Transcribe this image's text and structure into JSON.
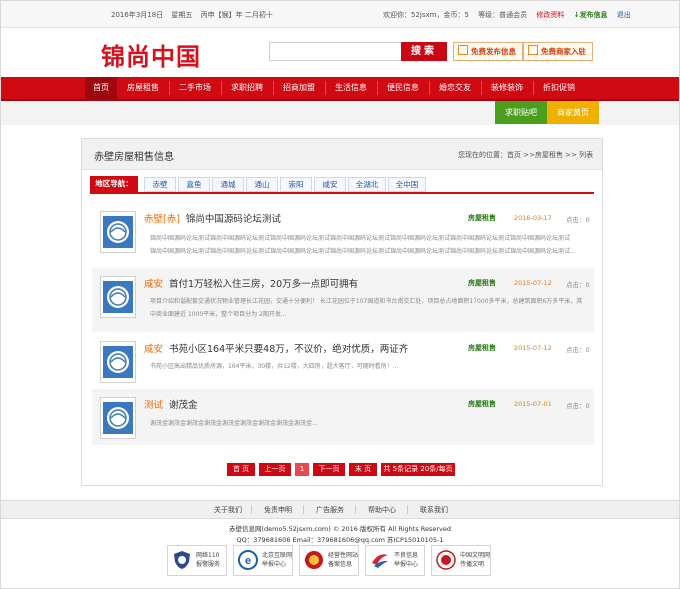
{
  "topbar": {
    "date": "2016年3月18日",
    "weekday": "星期五",
    "lunar": "丙申【猴】年 二月初十",
    "welcome": "欢迎你：52jsxm，金币：5",
    "level": "等级：普通会员",
    "edit_profile": "修改资料",
    "publish": "↓发布信息",
    "logout": "退出"
  },
  "header": {
    "logo_text": "锦尚中国",
    "search_button": "搜索",
    "free_publish": "免费发布信息",
    "free_merchant": "免费商家入驻"
  },
  "nav": {
    "items": [
      "首页",
      "房屋租售",
      "二手市场",
      "求职招聘",
      "招商加盟",
      "生活信息",
      "便民信息",
      "婚恋交友",
      "装修装饰",
      "折扣促销"
    ]
  },
  "sub_buttons": {
    "jobs": "求职贴吧",
    "merchants": "商家黄页"
  },
  "page": {
    "title": "赤壁房屋租售信息",
    "breadcrumb": "您现在的位置：首页 >>房屋租售 >> 列表"
  },
  "areas": {
    "label": "地区导航：",
    "items": [
      "赤壁",
      "嘉鱼",
      "通城",
      "通山",
      "崇阳",
      "咸安",
      "全湖北",
      "全中国"
    ]
  },
  "listings": [
    {
      "location": "赤壁[赤]",
      "title": "锦尚中国源码论坛测试",
      "category": "房屋租售",
      "date": "2016-03-17",
      "clicks": "点击：0",
      "desc1": "锦尚中国源码论坛测试锦尚中国源码论坛测试锦尚中国源码论坛测试锦尚中国源码论坛测试锦尚中国源码论坛测试锦尚中国源码论坛测试锦尚中国源码论坛测试",
      "desc2": "锦尚中国源码论坛测试锦尚中国源码论坛测试锦尚中国源码论坛测试锦尚中国源码论坛测试锦尚中国源码论坛测试锦尚中国源码论坛测试锦尚中国源码论坛测试..."
    },
    {
      "location": "咸安",
      "title": "首付1万轻松入住三房，20万多一点即可拥有",
      "category": "房屋租售",
      "date": "2015-07-12",
      "clicks": "点击：0",
      "desc1": "项目介绍和谐配套交通状况物业管理长江花园，交通十分便利！ 长江花园位于107国道和书台南交汇处，项目总占地面积17000多平米，总建筑面积6万多平米，其",
      "desc2": "中商业面建近 1000平米，整个项目分为 2期开发..."
    },
    {
      "location": "咸安",
      "title": "书苑小区164平米只要48万，不议价，绝对优质，两证齐",
      "category": "房屋租售",
      "date": "2015-07-12",
      "clicks": "点击：0",
      "desc1": "书苑小区高出精品优质房源，164平米，30楼，共12楼，大四房，超大客厅，可随时看房！...",
      "desc2": ""
    },
    {
      "location": "测试",
      "title": "谢茂金",
      "category": "房屋租售",
      "date": "2015-07-01",
      "clicks": "点击：0",
      "desc1": "谢茂金谢茂金谢茂金谢茂金谢茂金谢茂金谢茂金谢茂金谢茂金...",
      "desc2": ""
    }
  ],
  "pager": {
    "first": "首 页",
    "prev": "上一页",
    "current": "1",
    "next": "下一页",
    "last": "末 页",
    "summary": "共 5条记录 20条/每页"
  },
  "footer": {
    "links": [
      "关于我们",
      "免责申明",
      "广告服务",
      "帮助中心",
      "联系我们"
    ],
    "copyright": "赤壁信息网(demo5.52jsxm.com) © 2016 版权所有 All Rights Reserved",
    "contact": "QQ：379681606 Email：379681606@qq.com 苏ICP15010105-1",
    "badges": [
      {
        "l1": "网络110",
        "l2": "报警服务"
      },
      {
        "l1": "北京互联网",
        "l2": "举报中心"
      },
      {
        "l1": "经营性网站",
        "l2": "备案信息"
      },
      {
        "l1": "不良信息",
        "l2": "举报中心"
      },
      {
        "l1": "中国文明网",
        "l2": "传播文明"
      }
    ]
  },
  "colors": {
    "brand_red": "#cf0a13",
    "dark_red": "#9e070d",
    "green": "#4c9e1d",
    "yellow": "#f0b000",
    "location_orange": "#e86c0a",
    "category_green": "#2a7a18",
    "link_blue": "#2a57a4"
  }
}
